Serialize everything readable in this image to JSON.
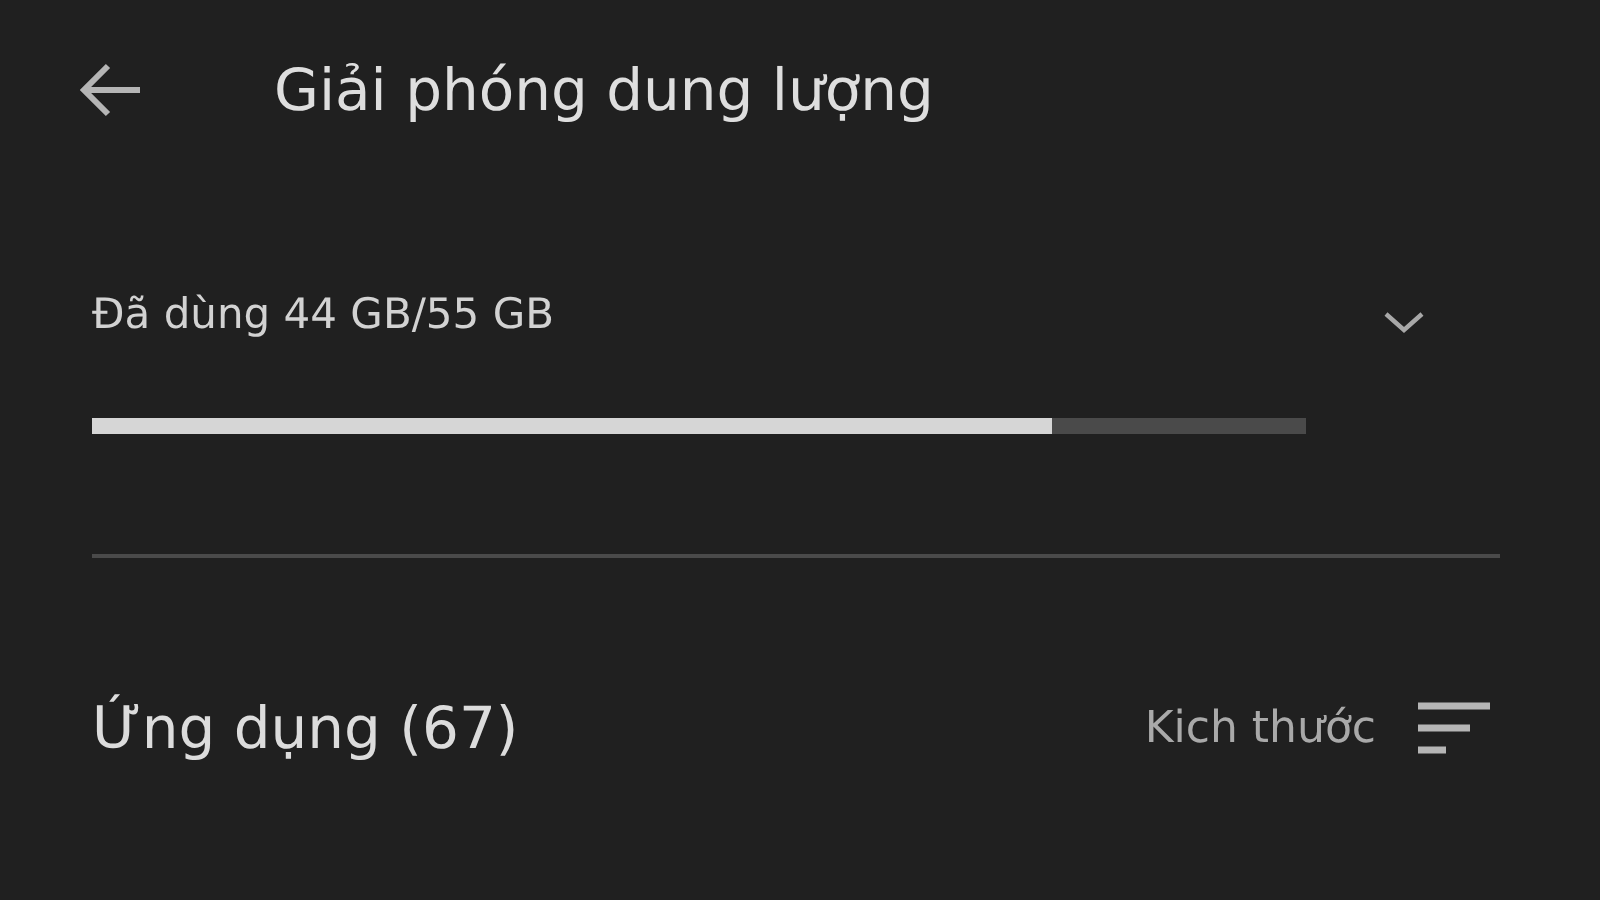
{
  "header": {
    "title": "Giải phóng dung lượng"
  },
  "storage": {
    "label": "Đã dùng 44 GB/55 GB",
    "level": 0.79
  },
  "apps": {
    "title": "Ứng dụng (67)",
    "sort_label": "Kich thước"
  }
}
